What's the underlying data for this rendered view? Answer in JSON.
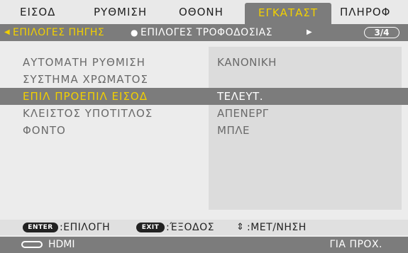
{
  "menu": {
    "tabs": [
      {
        "label": "ΕΙΣΟΔ"
      },
      {
        "label": "ΡΥΘΜΙΣΗ"
      },
      {
        "label": "ΟΘΟΝΗ"
      },
      {
        "label": "ΕΓΚΑΤΑΣΤ",
        "active": true
      },
      {
        "label": "ΠΛΗΡΟΦ"
      }
    ],
    "sub": {
      "active": "ΕΠΙΛΟΓΕΣ ΠΗΓΗΣ",
      "next": "ΕΠΙΛΟΓΕΣ ΤΡΟΦΟΔΟΣΙΑΣ",
      "page": "3/4"
    }
  },
  "settings": [
    {
      "label": "ΑΥΤΟΜΑΤΗ ΡΥΘΜΙΣΗ",
      "value": "ΚΑΝΟΝΙΚΗ"
    },
    {
      "label": "ΣΥΣΤΗΜΑ ΧΡΩΜΑΤΟΣ",
      "value": ""
    },
    {
      "label": "ΕΠΙΛ ΠΡΟΕΠΙΛ ΕΙΣΟΔ",
      "value": "ΤΕΛΕΥΤ.",
      "selected": true
    },
    {
      "label": "ΚΛΕΙΣΤΟΣ ΥΠΟΤΙΤΛΟΣ",
      "value": "ΑΠΕΝΕΡΓ"
    },
    {
      "label": "ΦΟΝΤΟ",
      "value": "ΜΠΛΕ"
    }
  ],
  "guide": {
    "enter_key": "ENTER",
    "enter_text": ":ΕΠΙΛΟΓΗ",
    "exit_key": "EXIT",
    "exit_text": ":ΈΞΟΔΟΣ",
    "move_glyph": "⇕",
    "move_text": ":ΜΕΤ/ΝΗΣΗ"
  },
  "status": {
    "source": "HDMI",
    "right": "ΓΙΑ ΠΡΟΧ."
  },
  "colors": {
    "highlight": "#f2d000",
    "bar": "#7c7c7c",
    "background": "#ececec"
  }
}
